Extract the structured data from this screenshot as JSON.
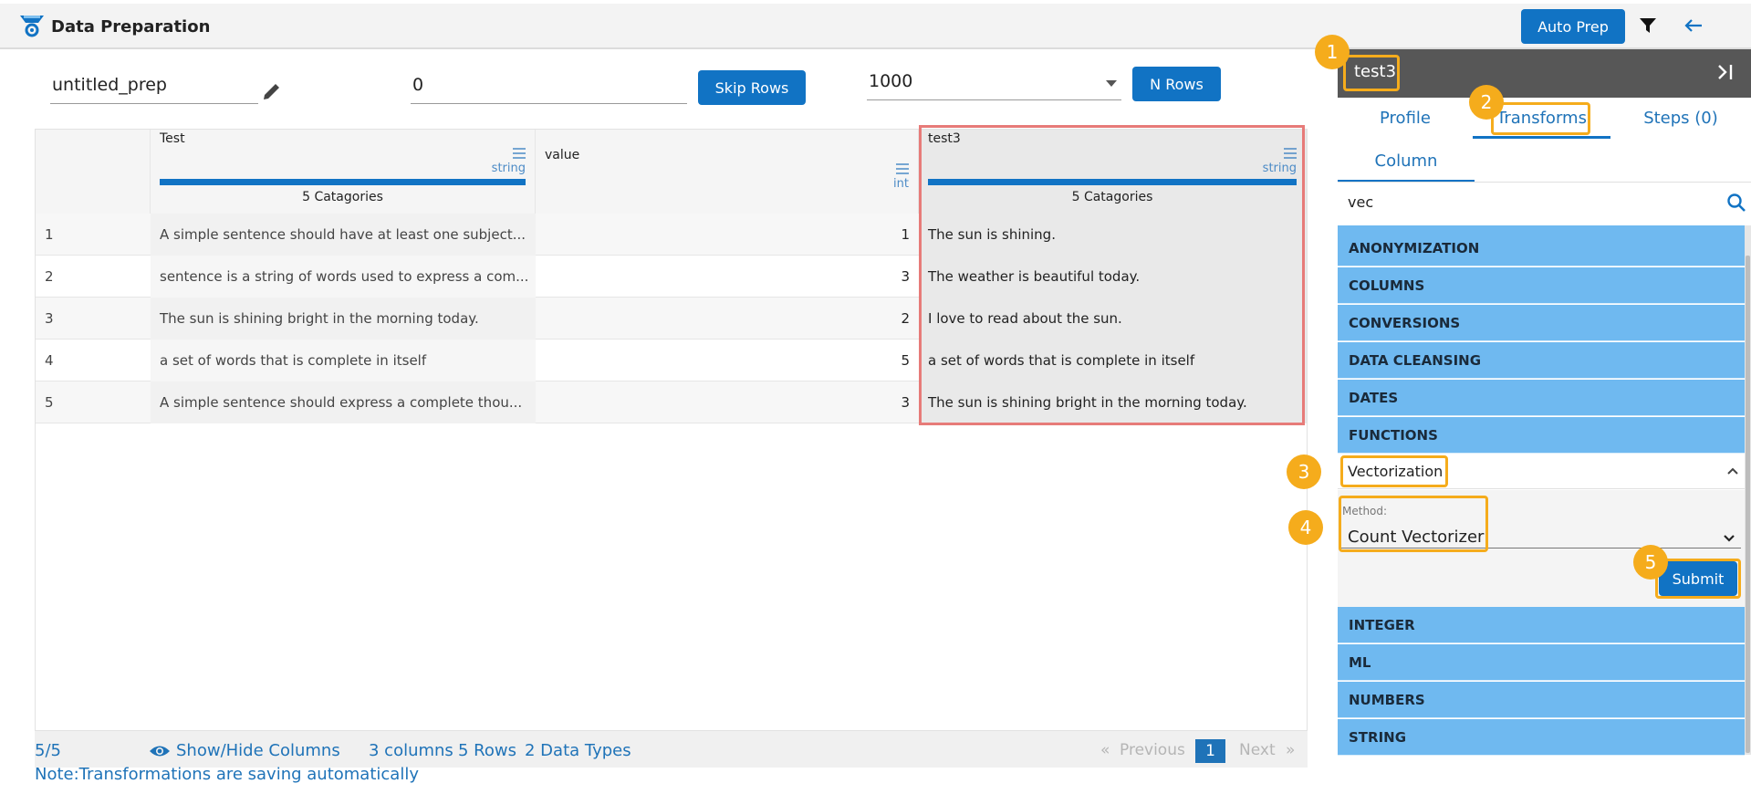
{
  "header": {
    "title": "Data Preparation",
    "auto_prep_label": "Auto Prep"
  },
  "controls": {
    "prep_name": "untitled_prep",
    "skip_value": "0",
    "skip_label": "Skip Rows",
    "nrows_value": "1000",
    "nrows_label": "N Rows"
  },
  "grid": {
    "columns": [
      {
        "name": "Test",
        "type": "string",
        "categories": "5 Catagories"
      },
      {
        "name": "value",
        "type": "int"
      },
      {
        "name": "test3",
        "type": "string",
        "categories": "5 Catagories"
      }
    ],
    "rows": [
      {
        "idx": "1",
        "test": "A simple sentence should have at least one subject...",
        "value": "1",
        "test3": "The sun is shining."
      },
      {
        "idx": "2",
        "test": "sentence is a string of words used to express a com...",
        "value": "3",
        "test3": "The weather is beautiful today."
      },
      {
        "idx": "3",
        "test": "The sun is shining bright in the morning today.",
        "value": "2",
        "test3": "I love to read about the sun."
      },
      {
        "idx": "4",
        "test": "a set of words that is complete in itself",
        "value": "5",
        "test3": "a set of words that is complete in itself"
      },
      {
        "idx": "5",
        "test": "A simple sentence should express a complete thou...",
        "value": "3",
        "test3": "The sun is shining bright in the morning today."
      }
    ]
  },
  "footer": {
    "count": "5/5",
    "show_hide": "Show/Hide Columns",
    "columns": "3 columns",
    "rows": "5 Rows",
    "types": "2 Data Types",
    "prev_arrows": "«",
    "previous": "Previous",
    "page": "1",
    "next": "Next",
    "next_arrows": "»",
    "note": "Note:Transformations are saving automatically"
  },
  "panel": {
    "column": "test3",
    "tabs": [
      "Profile",
      "Transforms",
      "Steps (0)"
    ],
    "subtab": "Column",
    "search": "vec",
    "categories_top": [
      "ANONYMIZATION",
      "COLUMNS",
      "CONVERSIONS",
      "DATA CLEANSING",
      "DATES",
      "FUNCTIONS"
    ],
    "vectorization": {
      "label": "Vectorization",
      "method_label": "Method:",
      "method_value": "Count Vectorizer",
      "submit": "Submit"
    },
    "categories_bottom": [
      "INTEGER",
      "ML",
      "NUMBERS",
      "STRING"
    ]
  },
  "annotations": [
    "1",
    "2",
    "3",
    "4",
    "5"
  ],
  "colors": {
    "primary": "#1173c4",
    "category": "#6fb9f0",
    "callout": "#f5ac1c",
    "selected_col": "#e77b79"
  }
}
